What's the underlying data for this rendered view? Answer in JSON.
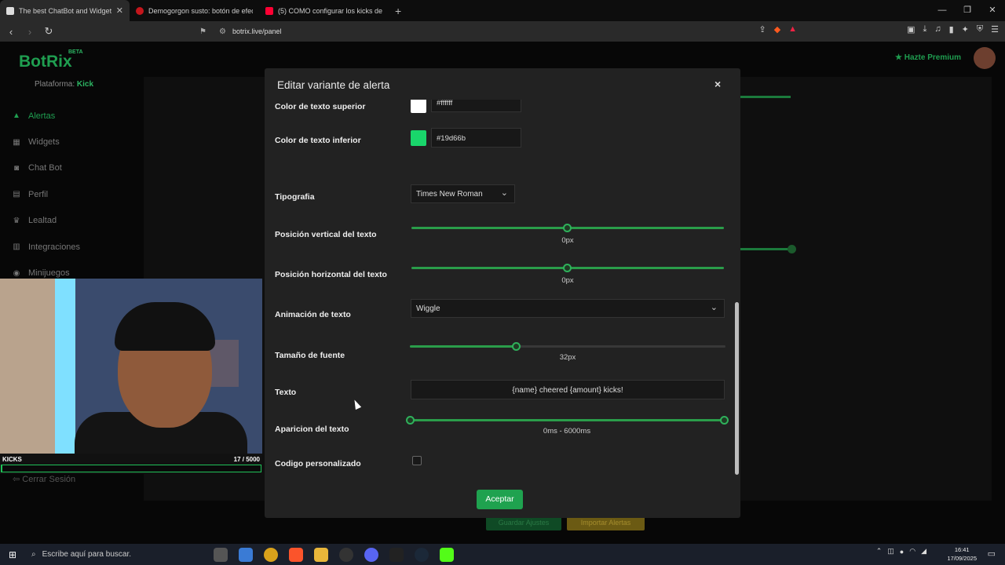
{
  "browser": {
    "tabs": [
      {
        "label": "The best ChatBot and Widgets f…",
        "color": "#e8e8e8",
        "active": true
      },
      {
        "label": "Demogorgon susto: botón de efecto",
        "color": "#c4161c",
        "active": false
      },
      {
        "label": "(5) COMO configurar los kicks de kic",
        "color": "#ff0033",
        "active": false
      }
    ],
    "new_tab": "+",
    "url": "botrix.live/panel"
  },
  "app": {
    "logo": "BotRix",
    "beta": "BETA",
    "platform_label": "Plataforma:",
    "platform_value": "Kick",
    "premium": "Hazte Premium",
    "sidebar": [
      {
        "label": "Alertas",
        "icon": "alert-icon",
        "active": true
      },
      {
        "label": "Widgets",
        "icon": "widgets-icon",
        "active": false
      },
      {
        "label": "Chat Bot",
        "icon": "robot-icon",
        "active": false
      },
      {
        "label": "Perfil",
        "icon": "profile-icon",
        "active": false
      },
      {
        "label": "Lealtad",
        "icon": "trophy-icon",
        "active": false
      },
      {
        "label": "Integraciones",
        "icon": "integrations-icon",
        "active": false
      },
      {
        "label": "Minijuegos",
        "icon": "gamepad-icon",
        "active": false
      }
    ],
    "logout": "Cerrar Sesión",
    "save_settings": "Guardar Ajustes",
    "import_alerts": "Importar Alertas"
  },
  "overlay": {
    "label": "KICKS",
    "count": "17  / 5000",
    "progress": 0.0034
  },
  "modal": {
    "title": "Editar variante de alerta",
    "close": "×",
    "top_text_color_label": "Color de texto superior",
    "top_text_color_hex": "#ffffff",
    "bottom_text_color_label": "Color de texto inferior",
    "bottom_text_color_hex": "#19d66b",
    "font_label": "Tipografia",
    "font_value": "Times New Roman",
    "vpos_label": "Posición vertical del texto",
    "vpos_value": "0px",
    "vpos_fraction": 0.5,
    "hpos_label": "Posición horizontal del texto",
    "hpos_value": "0px",
    "hpos_fraction": 0.5,
    "anim_label": "Animación de texto",
    "anim_value": "Wiggle",
    "fontsize_label": "Tamaño de fuente",
    "fontsize_value": "32px",
    "fontsize_fraction": 0.338,
    "text_label": "Texto",
    "text_value": "{name} cheered {amount} kicks!",
    "appear_label": "Aparicion del texto",
    "appear_value": "0ms - 6000ms",
    "custom_code_label": "Codigo personalizado",
    "custom_code_checked": false,
    "accept": "Aceptar",
    "accent": "#1fa24f"
  },
  "taskbar": {
    "search_placeholder": "Escribe aquí para buscar.",
    "time": "16:41",
    "date": "17/09/2025"
  }
}
